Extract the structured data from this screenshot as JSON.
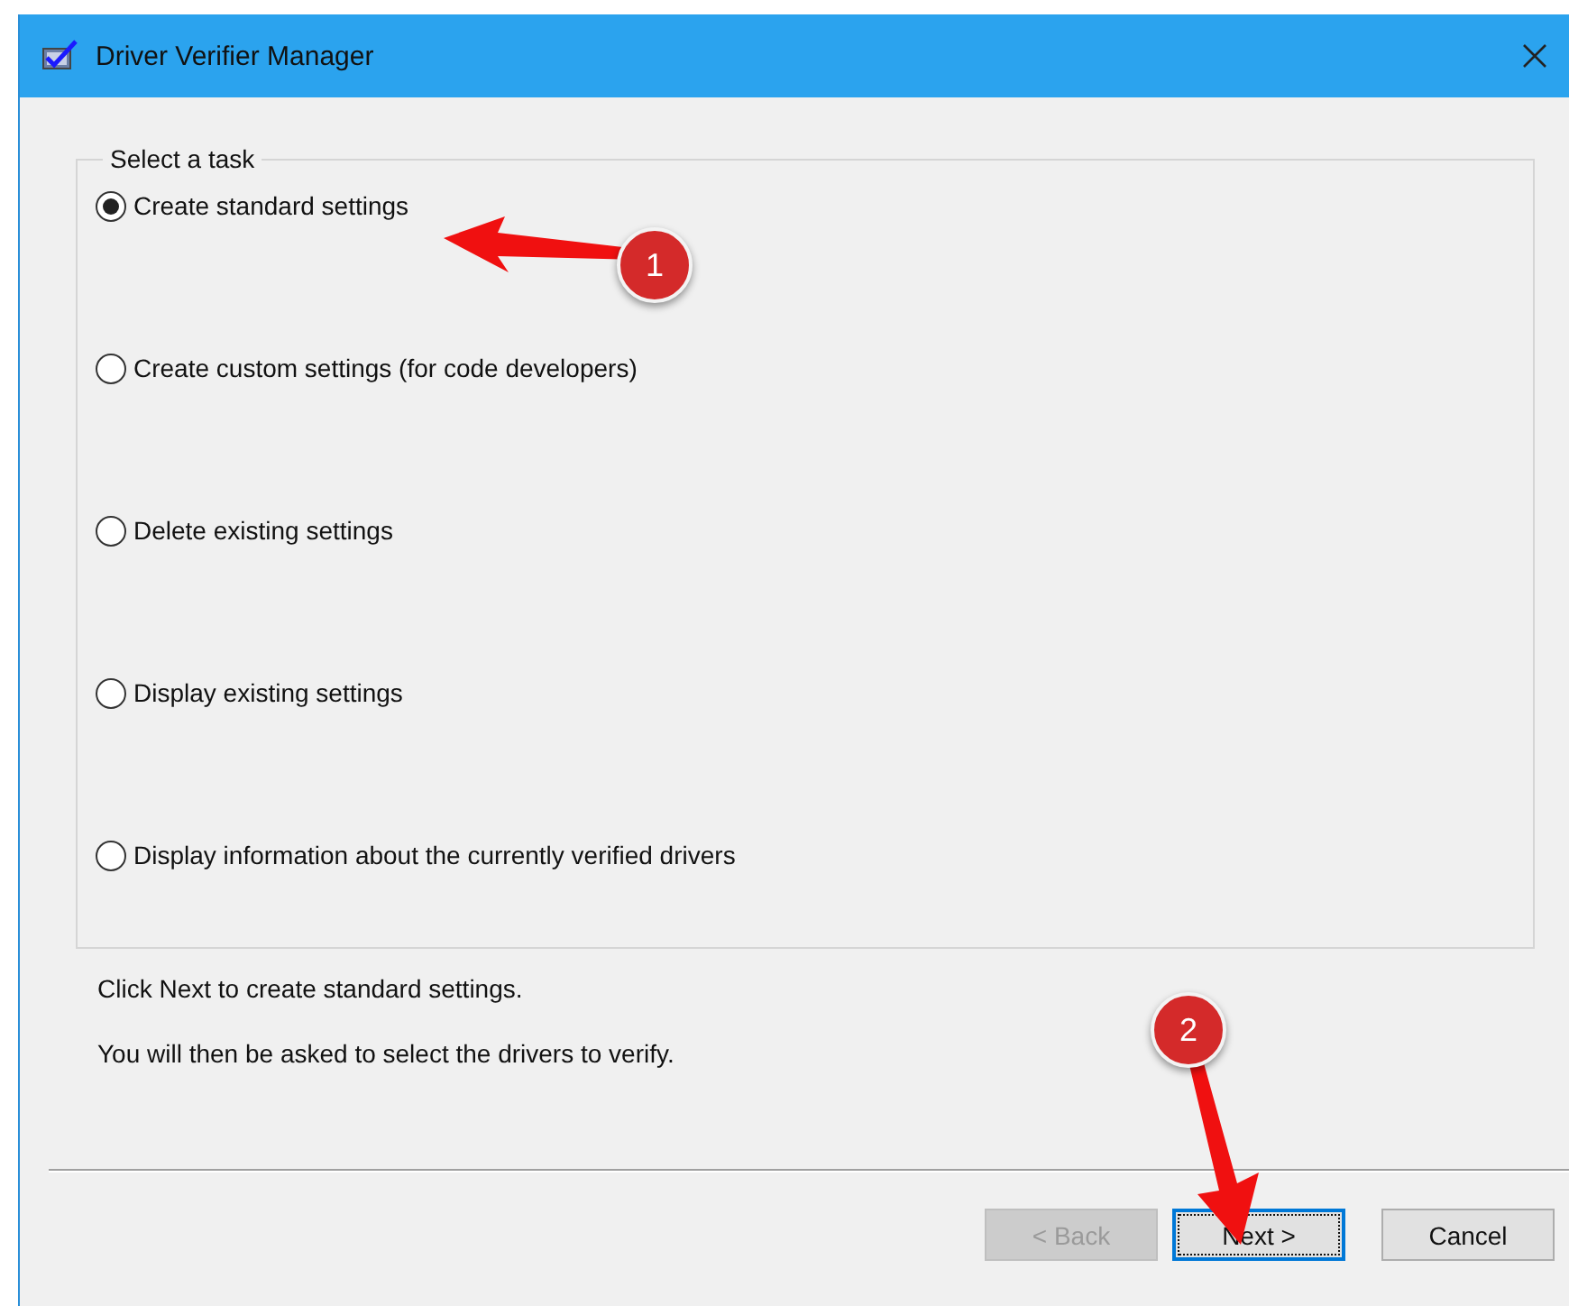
{
  "window": {
    "title": "Driver Verifier Manager"
  },
  "group": {
    "title": "Select a task",
    "options": [
      {
        "label": "Create standard settings",
        "selected": true
      },
      {
        "label": "Create custom settings (for code developers)",
        "selected": false
      },
      {
        "label": "Delete existing settings",
        "selected": false
      },
      {
        "label": "Display existing settings",
        "selected": false
      },
      {
        "label": "Display information about the currently verified drivers",
        "selected": false
      }
    ]
  },
  "info": [
    "Click Next to create standard settings.",
    "You will then be asked to select the drivers to verify."
  ],
  "buttons": [
    {
      "label": "< Back",
      "disabled": true,
      "focused": false
    },
    {
      "label": "Next >",
      "disabled": false,
      "focused": true
    },
    {
      "label": "Cancel",
      "disabled": false,
      "focused": false
    }
  ],
  "annotations": [
    {
      "number": "1"
    },
    {
      "number": "2"
    }
  ]
}
